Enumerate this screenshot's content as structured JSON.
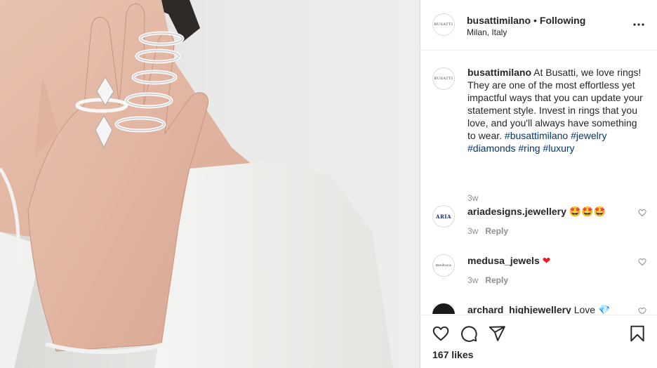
{
  "post": {
    "username": "busattimilano",
    "separator": "•",
    "follow_state": "Following",
    "location": "Milan, Italy",
    "avatar_text": "BUSATTI"
  },
  "caption": {
    "username": "busattimilano",
    "text": "At Busatti, we love rings! They are one of the most effortless yet impactful ways that you can update your statement style. Invest in rings that you love, and you'll always have something to wear.",
    "hashtags": [
      "#busattimilano",
      "#jewelry",
      "#diamonds",
      "#ring",
      "#luxury"
    ],
    "time": "3w"
  },
  "comments": [
    {
      "username": "ariadesigns.jewellery",
      "text": "🤩🤩🤩",
      "time": "3w",
      "reply_label": "Reply",
      "avatar_text": "ARIA"
    },
    {
      "username": "medusa_jewels",
      "text": "❤",
      "time": "3w",
      "reply_label": "Reply",
      "avatar_text": "medusa"
    },
    {
      "username": "archard_highjewellery",
      "text": "Love 💎",
      "time": "",
      "reply_label": "",
      "avatar_text": ""
    }
  ],
  "likes": "167 likes",
  "colors": {
    "hashtag": "#00376b",
    "muted": "#8e8e8e",
    "text": "#262626",
    "border": "#dbdbdb"
  },
  "icons": [
    "more-options-icon",
    "like-heart-icon",
    "comment-icon",
    "share-icon",
    "save-bookmark-icon",
    "comment-like-icon"
  ]
}
